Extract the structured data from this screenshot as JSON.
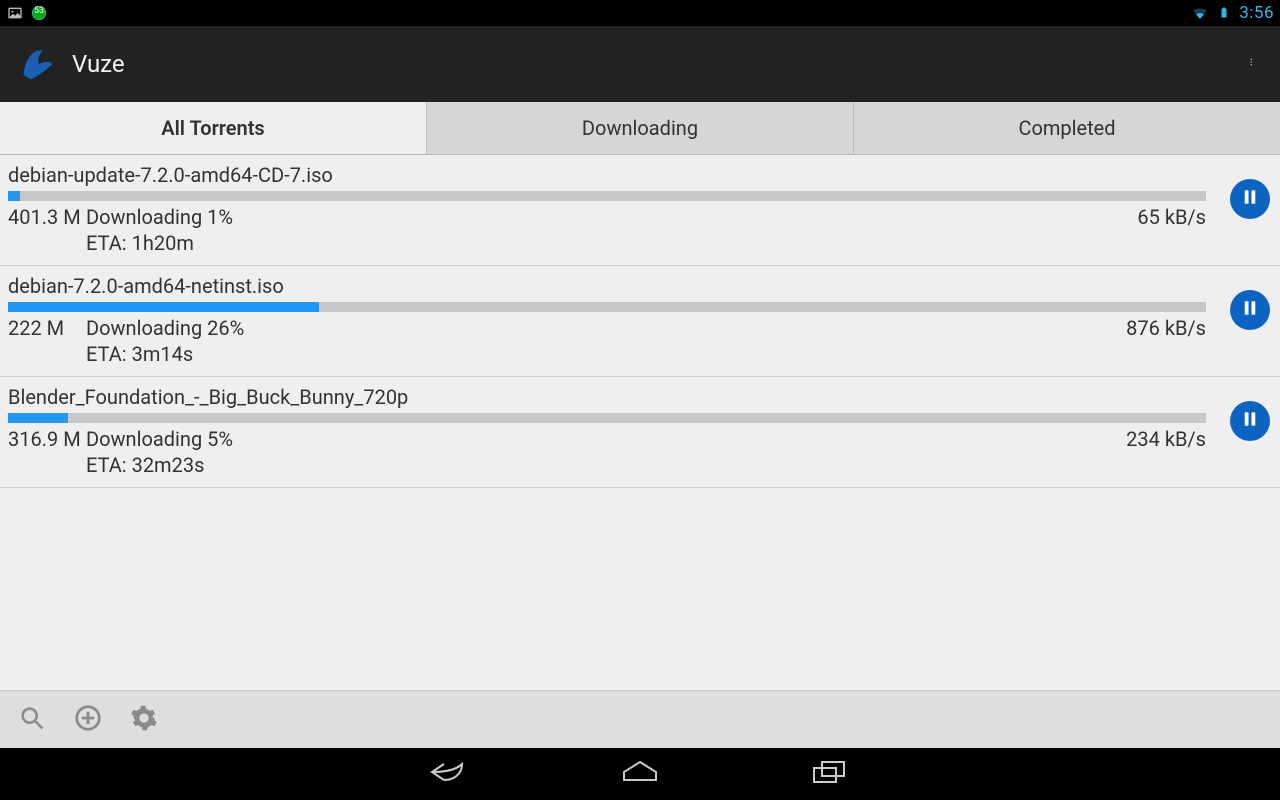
{
  "status": {
    "clock": "3:56",
    "battery_icon": "battery-icon",
    "wifi_icon": "wifi-icon",
    "notif_count": "53"
  },
  "header": {
    "app_title": "Vuze"
  },
  "tabs": [
    {
      "label": "All Torrents",
      "active": true
    },
    {
      "label": "Downloading",
      "active": false
    },
    {
      "label": "Completed",
      "active": false
    }
  ],
  "torrents": [
    {
      "name": "debian-update-7.2.0-amd64-CD-7.iso",
      "size": "401.3 M",
      "status": "Downloading 1%",
      "speed": "65 kB/s",
      "eta": "ETA: 1h20m",
      "progress_pct": 1
    },
    {
      "name": "debian-7.2.0-amd64-netinst.iso",
      "size": "222 M",
      "status": "Downloading 26%",
      "speed": "876 kB/s",
      "eta": "ETA: 3m14s",
      "progress_pct": 26
    },
    {
      "name": "Blender_Foundation_-_Big_Buck_Bunny_720p",
      "size": "316.9 M",
      "status": "Downloading 5%",
      "speed": "234 kB/s",
      "eta": "ETA: 32m23s",
      "progress_pct": 5
    }
  ],
  "colors": {
    "accent": "#2196f3",
    "pause_button": "#0d63c2",
    "holo_blue": "#33b5e5"
  }
}
